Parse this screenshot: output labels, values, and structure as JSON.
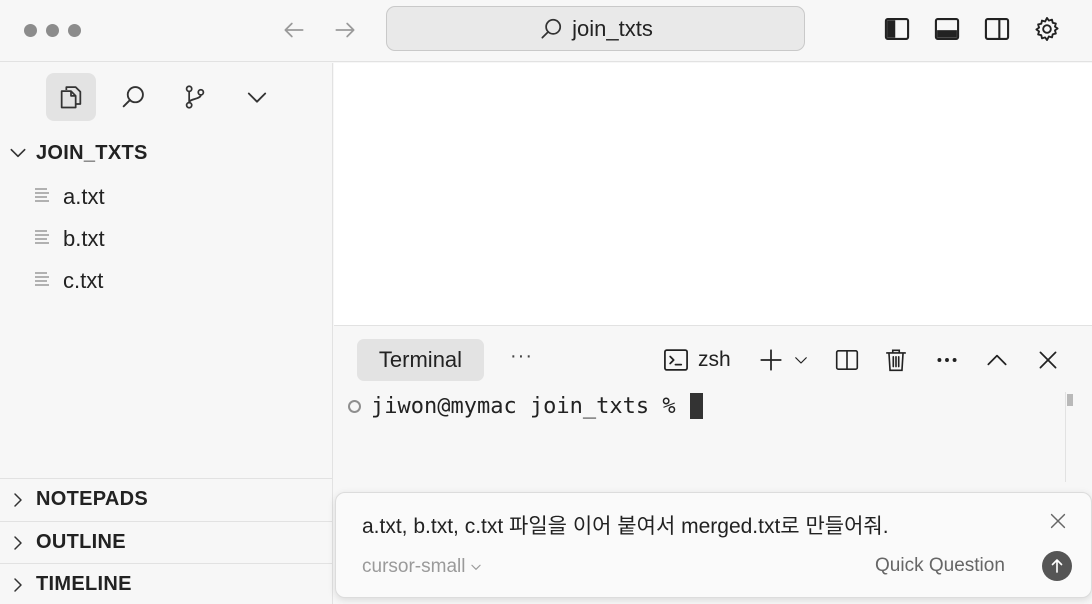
{
  "titlebar": {
    "search_text": "join_txts",
    "icons": [
      "back-arrow-icon",
      "forward-arrow-icon",
      "search-icon",
      "toggle-sidebar-icon",
      "toggle-panel-icon",
      "toggle-secondary-sidebar-icon",
      "settings-gear-icon"
    ]
  },
  "sidebar": {
    "tools": [
      "files-icon",
      "search-icon",
      "source-control-icon",
      "chevron-down-icon"
    ],
    "folder_name": "JOIN_TXTS",
    "files": [
      {
        "name": "a.txt"
      },
      {
        "name": "b.txt"
      },
      {
        "name": "c.txt"
      }
    ],
    "sections": [
      {
        "label": "NOTEPADS"
      },
      {
        "label": "OUTLINE"
      },
      {
        "label": "TIMELINE"
      }
    ]
  },
  "panel": {
    "tab_label": "Terminal",
    "more_label": "···",
    "shell_label": "zsh",
    "prompt": "jiwon@mymac join_txts %"
  },
  "quick_question": {
    "input_text": "a.txt, b.txt, c.txt 파일을 이어 붙여서 merged.txt로 만들어줘.",
    "model": "cursor-small",
    "mode": "Quick Question"
  },
  "colors": {
    "background": "#f7f7f7",
    "editor": "#ffffff",
    "active_tab": "#e3e3e3",
    "text": "#222222",
    "muted": "#9a9a9a"
  }
}
